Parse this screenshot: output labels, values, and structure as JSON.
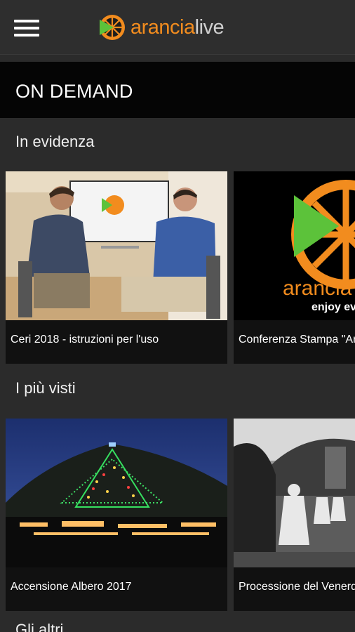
{
  "brand": {
    "name_part1": "arancia",
    "name_part2": "live",
    "accent": "#f28c1e"
  },
  "header": {
    "menu_icon": "hamburger-menu-icon"
  },
  "page": {
    "title": "ON DEMAND"
  },
  "sections": {
    "featured": {
      "title": "In evidenza",
      "items": [
        {
          "caption": "Ceri 2018 - istruzioni per l'uso"
        },
        {
          "caption": "Conferenza Stampa \"Arancia Live\""
        }
      ]
    },
    "most_viewed": {
      "title": "I più visti",
      "items": [
        {
          "caption": "Accensione Albero 2017"
        },
        {
          "caption": "Processione del Venerdì Santo"
        }
      ]
    },
    "others": {
      "title": "Gli altri"
    }
  },
  "promo": {
    "brand_text": "arancia",
    "tagline": "enjoy every"
  }
}
